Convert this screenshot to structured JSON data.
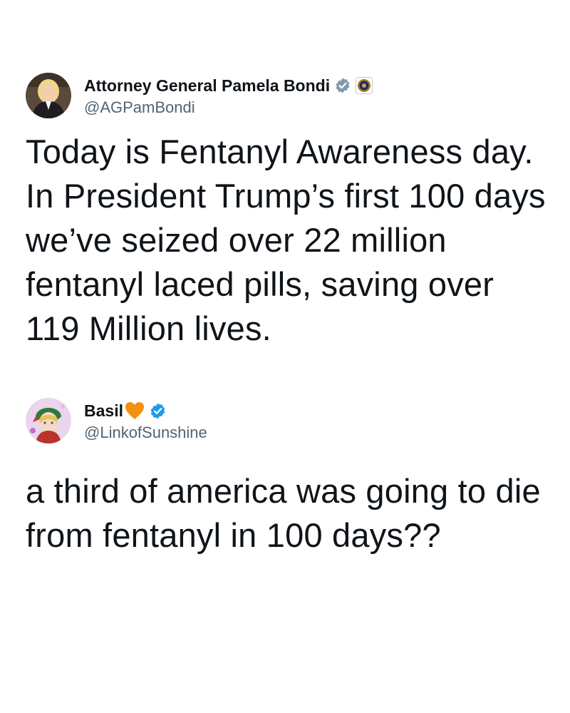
{
  "tweets": [
    {
      "display_name": "Attorney General Pamela Bondi",
      "handle": "@AGPamBondi",
      "verified_badge": "gray-checkmark-badge",
      "affiliation_icon": "doj-seal-icon",
      "text": "Today is Fentanyl Awareness day. In President Trump’s first 100 days we’ve seized over 22 million fentanyl laced pills, saving over 119 Million lives."
    },
    {
      "display_name": "Basil",
      "name_emoji": "orange-heart-icon",
      "handle": "@LinkofSunshine",
      "verified_badge": "blue-checkmark-badge",
      "text": "a third of america was going to die from fentanyl in 100 days??"
    }
  ],
  "colors": {
    "text": "#0f1419",
    "handle": "#536471",
    "blue_check": "#1d9bf0",
    "gray_check": "#829aab",
    "orange_heart": "#f4900c"
  }
}
